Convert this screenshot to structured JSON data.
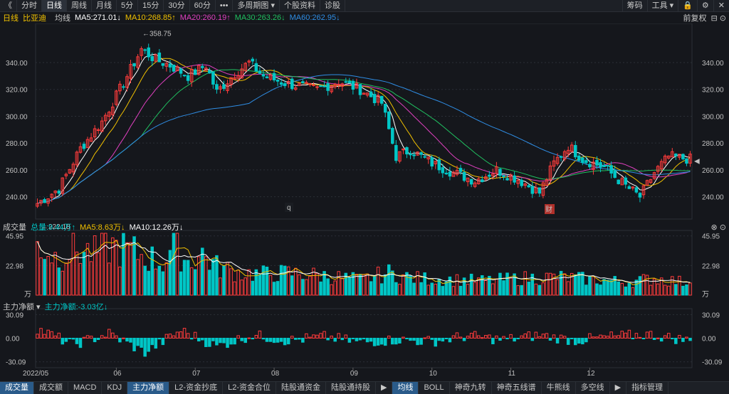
{
  "toolbar": {
    "left_items": [
      "《",
      "分时",
      "日线",
      "周线",
      "月线",
      "5分",
      "15分",
      "30分",
      "60分",
      "•••",
      "多周期图 ▾",
      "个股资料",
      "诊股"
    ],
    "active_index": 2,
    "right_items": [
      "筹码",
      "工具 ▾"
    ]
  },
  "price_panel": {
    "label_period": "日线",
    "label_name": "比亚迪",
    "label_ma": "均线",
    "ma_labels": [
      {
        "text": "MA5:271.01↓",
        "color": "#ffffff"
      },
      {
        "text": "MA10:268.85↑",
        "color": "#f0c000"
      },
      {
        "text": "MA20:260.19↑",
        "color": "#e040c0"
      },
      {
        "text": "MA30:263.26↓",
        "color": "#20c060"
      },
      {
        "text": "MA60:262.95↓",
        "color": "#2f8de4"
      }
    ],
    "right_label": "前复权",
    "high_label": "358.75",
    "low_label": "222.18",
    "current_price_label": "◀",
    "event_markers": [
      "q",
      "财"
    ]
  },
  "volume_panel": {
    "label": "成交量",
    "total": "总量:9.44万↑",
    "ma5": "MA5:8.63万↓",
    "ma10": "MA10:12.26万↓",
    "unit": "万"
  },
  "flow_panel": {
    "label": "主力净额 ▾",
    "value": "主力净额:-3.03亿↓"
  },
  "bottom_tabs": [
    "成交量",
    "成交额",
    "MACD",
    "KDJ",
    "主力净额",
    "L2-资金抄底",
    "L2-资金合位",
    "陆股通资金",
    "陆股通持股",
    "▶",
    "均线",
    "BOLL",
    "神奇九转",
    "神奇五线谱",
    "牛熊线",
    "多空线",
    "▶",
    "指标管理"
  ],
  "bottom_active": [
    0,
    4,
    10
  ],
  "colors": {
    "up": "#ff3b3b",
    "down": "#00c6c6",
    "grid": "#2b2f36"
  },
  "chart_data": {
    "type": "candlestick",
    "title": "比亚迪 日线",
    "months": [
      "2022/05",
      "06",
      "07",
      "08",
      "09",
      "10",
      "11",
      "12"
    ],
    "price_axis": {
      "ticks": [
        240,
        260,
        280,
        300,
        320,
        340
      ],
      "labels": [
        "240.00",
        "260.00",
        "280.00",
        "300.00",
        "320.00",
        "340.00"
      ],
      "range": [
        226,
        366
      ]
    },
    "volume_axis": {
      "ticks": [
        22.98,
        45.95
      ],
      "labels": [
        "22.98",
        "45.95"
      ],
      "range": [
        0,
        48
      ]
    },
    "flow_axis": {
      "ticks": [
        30.09,
        0,
        -30.09
      ],
      "labels": [
        "30.09",
        "0.00",
        "-30.09"
      ],
      "range": [
        -34,
        34
      ]
    },
    "ma_last": {
      "MA5": 271.01,
      "MA10": 268.85,
      "MA20": 260.19,
      "MA30": 263.26,
      "MA60": 262.95
    },
    "close_keypoints": [
      [
        0,
        235
      ],
      [
        6,
        246
      ],
      [
        12,
        276
      ],
      [
        18,
        296
      ],
      [
        24,
        325
      ],
      [
        29,
        350
      ],
      [
        33,
        342
      ],
      [
        37,
        338
      ],
      [
        42,
        330
      ],
      [
        47,
        338
      ],
      [
        50,
        318
      ],
      [
        55,
        332
      ],
      [
        59,
        340
      ],
      [
        63,
        330
      ],
      [
        70,
        324
      ],
      [
        78,
        320
      ],
      [
        84,
        326
      ],
      [
        90,
        320
      ],
      [
        96,
        310
      ],
      [
        100,
        270
      ],
      [
        104,
        275
      ],
      [
        110,
        265
      ],
      [
        116,
        258
      ],
      [
        122,
        252
      ],
      [
        128,
        260
      ],
      [
        134,
        253
      ],
      [
        140,
        243
      ],
      [
        144,
        265
      ],
      [
        148,
        278
      ],
      [
        152,
        268
      ],
      [
        158,
        262
      ],
      [
        164,
        248
      ],
      [
        168,
        240
      ],
      [
        172,
        258
      ],
      [
        176,
        270
      ],
      [
        182,
        268
      ]
    ],
    "volume_keypoints": [
      [
        0,
        40
      ],
      [
        5,
        30
      ],
      [
        10,
        36
      ],
      [
        16,
        32
      ],
      [
        20,
        38
      ],
      [
        25,
        35
      ],
      [
        30,
        30
      ],
      [
        35,
        25
      ],
      [
        38,
        39
      ],
      [
        42,
        26
      ],
      [
        46,
        32
      ],
      [
        50,
        22
      ],
      [
        55,
        18
      ],
      [
        62,
        16
      ],
      [
        70,
        17
      ],
      [
        80,
        15
      ],
      [
        90,
        12
      ],
      [
        98,
        17
      ],
      [
        105,
        13
      ],
      [
        115,
        12
      ],
      [
        125,
        11
      ],
      [
        135,
        13
      ],
      [
        145,
        14
      ],
      [
        155,
        12
      ],
      [
        165,
        10
      ],
      [
        172,
        13
      ],
      [
        182,
        9.44
      ]
    ],
    "flow_keypoints": [
      [
        0,
        12
      ],
      [
        10,
        -8
      ],
      [
        20,
        6
      ],
      [
        30,
        -18
      ],
      [
        40,
        10
      ],
      [
        50,
        -10
      ],
      [
        60,
        4
      ],
      [
        70,
        -3
      ],
      [
        80,
        2
      ],
      [
        90,
        -5
      ],
      [
        100,
        -2
      ],
      [
        110,
        -4
      ],
      [
        120,
        3
      ],
      [
        130,
        -2
      ],
      [
        140,
        4
      ],
      [
        150,
        -3
      ],
      [
        160,
        2
      ],
      [
        170,
        5
      ],
      [
        182,
        -3.03
      ]
    ],
    "volume_total_last": 9.44,
    "volume_ma5_last": 8.63,
    "volume_ma10_last": 12.26,
    "flow_last": -3.03,
    "high": 358.75,
    "low": 222.18
  }
}
